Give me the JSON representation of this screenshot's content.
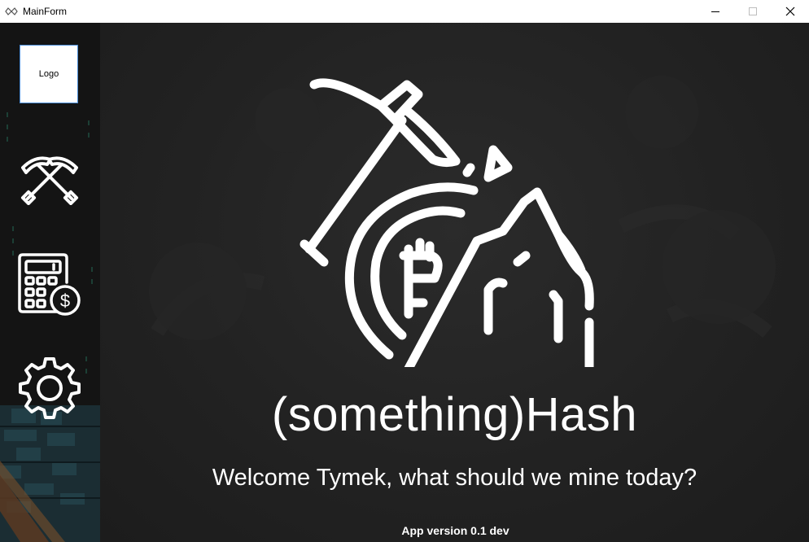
{
  "window": {
    "title": "MainForm",
    "controls": [
      "minimize",
      "maximize",
      "close"
    ]
  },
  "sidebar": {
    "logo_text": "Logo",
    "items": [
      {
        "icon": "crossed-pickaxes-icon",
        "label": ""
      },
      {
        "icon": "calculator-dollar-icon",
        "label": ""
      },
      {
        "icon": "gear-icon",
        "label": ""
      }
    ]
  },
  "main": {
    "hero_icon": "pickaxe-bitcoin-mine-icon",
    "app_title": "(something)Hash",
    "welcome_text": "Welcome Tymek, what should we mine today?",
    "version_text": "App version 0.1 dev"
  },
  "colors": {
    "sidebar_bg": "#141414",
    "main_bg": "#222222",
    "text": "#ffffff",
    "logo_border": "#4a8cd6"
  }
}
